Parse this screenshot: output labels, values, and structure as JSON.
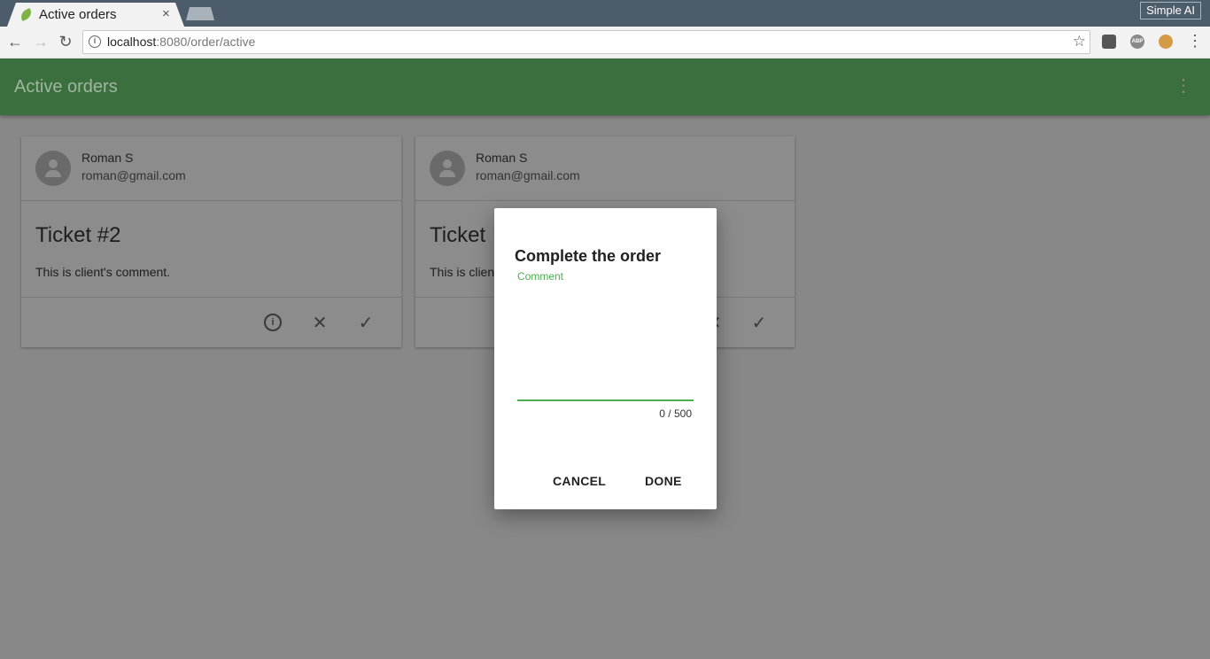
{
  "browser": {
    "tab_title": "Active orders",
    "tab_close": "×",
    "profile": "Simple AI",
    "url_host": "localhost",
    "url_rest": ":8080/order/active",
    "ext_abp": "ABP"
  },
  "app": {
    "title": "Active orders",
    "more_icon": "⋮"
  },
  "cards": [
    {
      "name": "Roman S",
      "email": "roman@gmail.com",
      "ticket": "Ticket #2",
      "comment": "This is client's comment."
    },
    {
      "name": "Roman S",
      "email": "roman@gmail.com",
      "ticket": "Ticket",
      "comment": "This is clien"
    }
  ],
  "dialog": {
    "title": "Complete the order",
    "field_label": "Comment",
    "field_value": "",
    "counter": "0 / 500",
    "cancel_label": "CANCEL",
    "done_label": "DONE"
  },
  "icons": {
    "info": "i",
    "close": "✕",
    "check": "✓"
  }
}
